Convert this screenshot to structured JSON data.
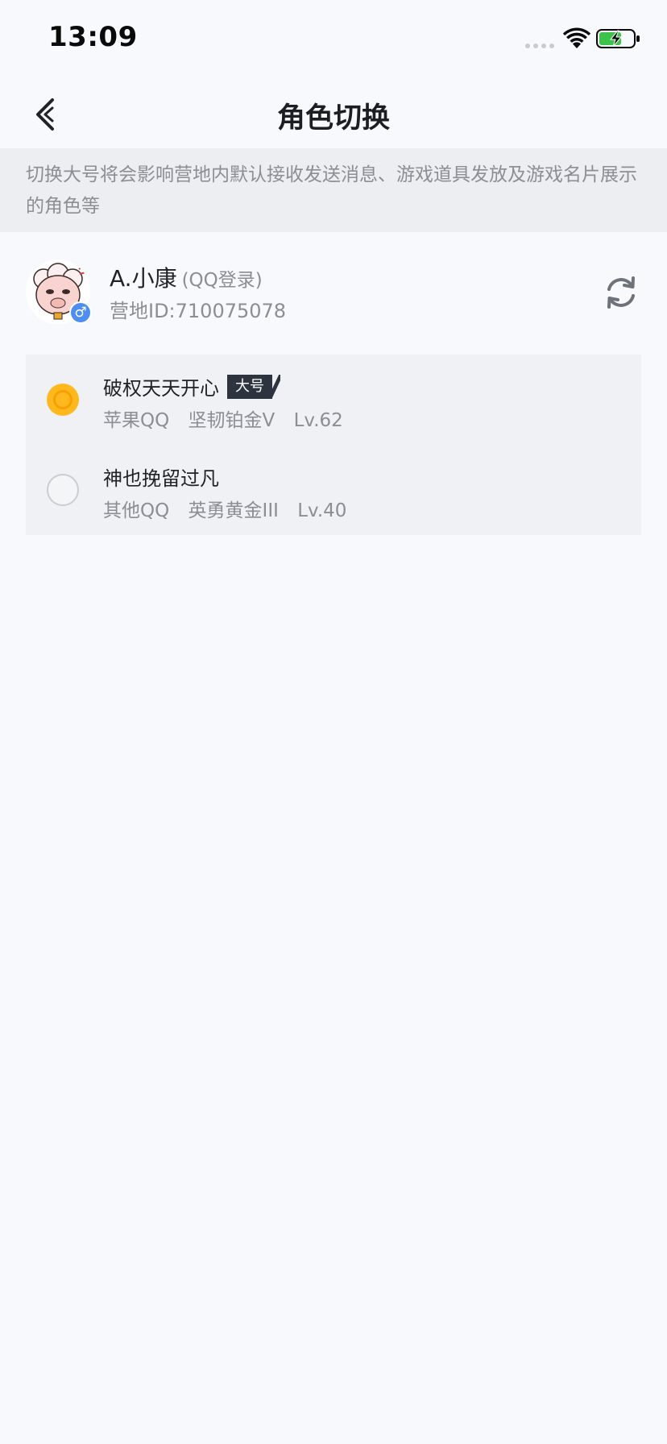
{
  "status_bar": {
    "time": "13:09",
    "icons": [
      "signal-dots-icon",
      "wifi-icon",
      "battery-charging-icon"
    ],
    "battery_color": "#3DC24A"
  },
  "nav": {
    "back_icon": "chevron-left-icon",
    "title": "角色切换"
  },
  "notice": {
    "text": "切换大号将会影响营地内默认接收发送消息、游戏道具发放及游戏名片展示的角色等"
  },
  "account": {
    "name": "A.小康",
    "login_type": "(QQ登录)",
    "camp_id": "营地ID:710075078",
    "gender_symbol": "♂",
    "refresh_icon": "refresh-icon"
  },
  "roles": [
    {
      "name": "破权天天开心",
      "tag": "大号",
      "platform": "苹果QQ",
      "rank": "坚韧铂金V",
      "level": "Lv.62",
      "selected": true
    },
    {
      "name": "神也挽留过凡",
      "tag": "",
      "platform": "其他QQ",
      "rank": "英勇黄金III",
      "level": "Lv.40",
      "selected": false
    }
  ],
  "colors": {
    "background": "#F7F9FC",
    "notice_background": "#ECEEF1",
    "selected_radio": "#FFB81E",
    "tag_background": "#2D3440",
    "gender_badge": "#4E8EF0"
  }
}
